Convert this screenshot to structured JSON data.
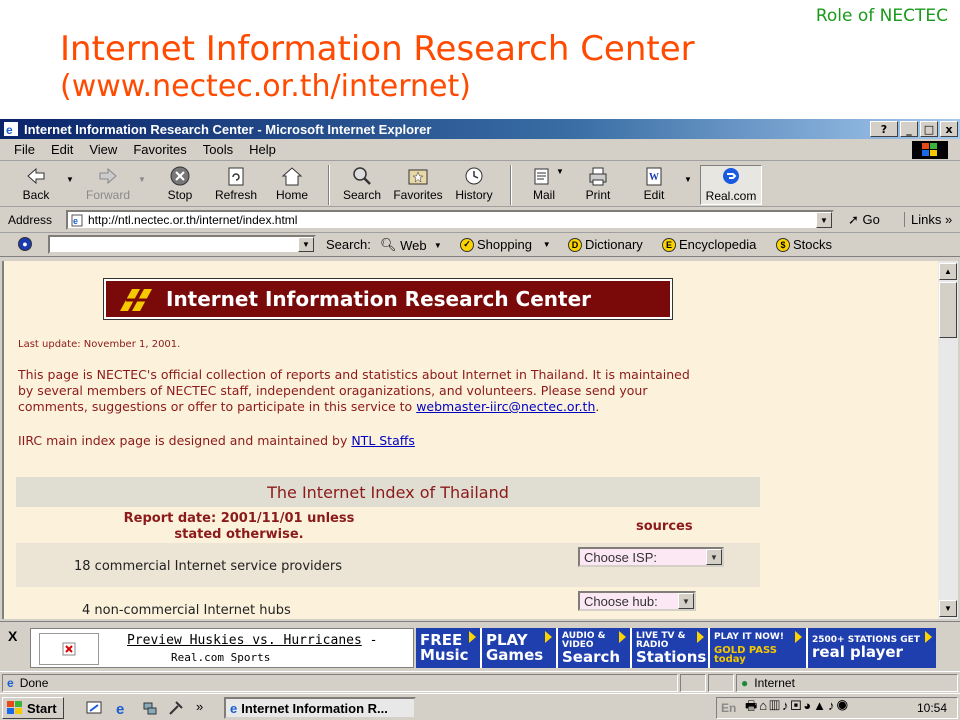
{
  "slide": {
    "corner": "Role of NECTEC",
    "title": "Internet Information Research Center",
    "url": "(www.nectec.or.th/internet)"
  },
  "window": {
    "title": "Internet Information Research Center - Microsoft Internet Explorer",
    "controls": [
      "?",
      "_",
      "□",
      "x"
    ]
  },
  "menu": [
    "File",
    "Edit",
    "View",
    "Favorites",
    "Tools",
    "Help"
  ],
  "toolbar": {
    "back": "Back",
    "forward": "Forward",
    "stop": "Stop",
    "refresh": "Refresh",
    "home": "Home",
    "search": "Search",
    "favorites": "Favorites",
    "history": "History",
    "mail": "Mail",
    "print": "Print",
    "edit": "Edit",
    "real": "Real.com"
  },
  "address": {
    "label": "Address",
    "url": "http://ntl.nectec.or.th/internet/index.html",
    "go": "Go",
    "links": "Links"
  },
  "searchbar": {
    "label": "Search:",
    "web": "Web",
    "shopping": "Shopping",
    "dictionary": "Dictionary",
    "encyclopedia": "Encyclopedia",
    "stocks": "Stocks"
  },
  "page": {
    "banner": "Internet Information Research Center",
    "last_update": "Last update: November 1, 2001.",
    "intro_1": "This page is NECTEC's official collection of reports and statistics about Internet in Thailand. It is maintained",
    "intro_2": "by several members of NECTEC staff, independent oraganizations, and volunteers. Please send your",
    "intro_3": "comments, suggestions or offer to participate in this service to",
    "intro_email": "webmaster-iirc@nectec.or.th",
    "intro_end": ".",
    "designed": "IIRC main index page is designed and maintained by",
    "designed_link": "NTL Staffs",
    "index_title": "The Internet Index of Thailand",
    "report_date_1": "Report date: 2001/11/01 unless",
    "report_date_2": "stated otherwise.",
    "sources": "sources",
    "row1": "18 commercial Internet service providers",
    "row1_select": "Choose ISP:",
    "row2": "4 non-commercial Internet hubs",
    "row2_select": "Choose hub:"
  },
  "ad": {
    "close": "X",
    "link": "Preview Huskies vs. Hurricanes",
    "link_dash": "-",
    "sub": "Real.com Sports",
    "cells": [
      {
        "top": "FREE",
        "bottom": "Music"
      },
      {
        "top": "PLAY",
        "bottom": "Games"
      },
      {
        "top": "AUDIO & VIDEO",
        "bottom": "Search"
      },
      {
        "top": "LIVE TV & RADIO",
        "bottom": "Stations"
      },
      {
        "top": "PLAY IT NOW!",
        "bottom": "GOLD PASS today"
      },
      {
        "top": "2500+ STATIONS GET",
        "bottom": "real player"
      }
    ]
  },
  "status": {
    "done": "Done",
    "zone": "Internet"
  },
  "taskbar": {
    "start": "Start",
    "task": "Internet Information R...",
    "lang": "En",
    "clock": "10:54"
  }
}
